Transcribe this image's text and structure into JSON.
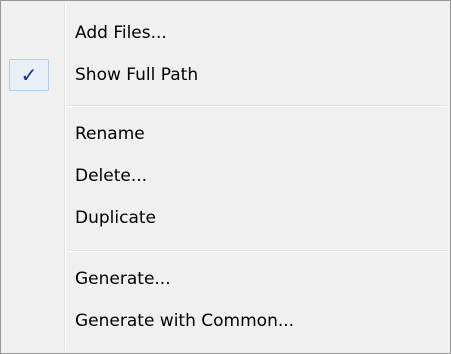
{
  "menu": {
    "items": [
      {
        "label": "Add Files..."
      },
      {
        "label": "Show Full Path",
        "checked": true,
        "check_glyph": "✓"
      },
      {
        "label": "Rename"
      },
      {
        "label": "Delete..."
      },
      {
        "label": "Duplicate"
      },
      {
        "label": "Generate..."
      },
      {
        "label": "Generate with Common..."
      }
    ]
  },
  "colors": {
    "menu_background": "#f0f0f0",
    "menu_border": "#979797",
    "check_highlight": "#e8eff7",
    "check_mark": "#0b3a8c"
  },
  "icons": {
    "check": "checkmark-icon"
  }
}
